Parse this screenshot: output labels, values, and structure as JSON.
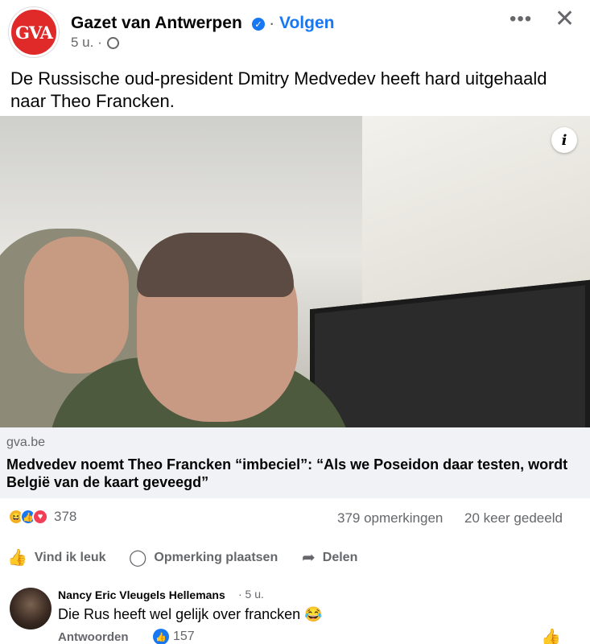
{
  "header": {
    "logo_text": "GVA",
    "page_name": "Gazet van Antwerpen",
    "separator": "·",
    "follow_label": "Volgen",
    "time": "5 u. ·"
  },
  "post": {
    "text": "De Russische oud-president Dmitry Medvedev heeft hard uitgehaald naar Theo Francken."
  },
  "link": {
    "domain": "gva.be",
    "title": "Medvedev noemt Theo Francken “imbeciel”: “Als we Poseidon daar testen, wordt België van de kaart geveegd”"
  },
  "stats": {
    "reactions_count": "378",
    "comments": "379 opmerkingen",
    "shares": "20 keer gedeeld"
  },
  "actions": {
    "like": "Vind ik leuk",
    "comment": "Opmerking plaatsen",
    "share": "Delen"
  },
  "comment": {
    "author": "Nancy Eric Vleugels Hellemans",
    "time": "· 5 u.",
    "text": "Die Rus heeft wel gelijk over francken 😂",
    "reply_label": "Antwoorden",
    "likes": "157"
  },
  "colors": {
    "accent": "#1877f2",
    "logo_red": "#e02a2a",
    "muted_text": "#65676b",
    "link_box_bg": "#f0f2f5"
  },
  "icons": [
    "verified-badge-icon",
    "globe-icon",
    "more-icon",
    "close-icon",
    "info-icon",
    "haha-reaction-icon",
    "like-reaction-icon",
    "love-reaction-icon",
    "thumbs-up-icon",
    "comment-bubble-icon",
    "share-arrow-icon"
  ]
}
